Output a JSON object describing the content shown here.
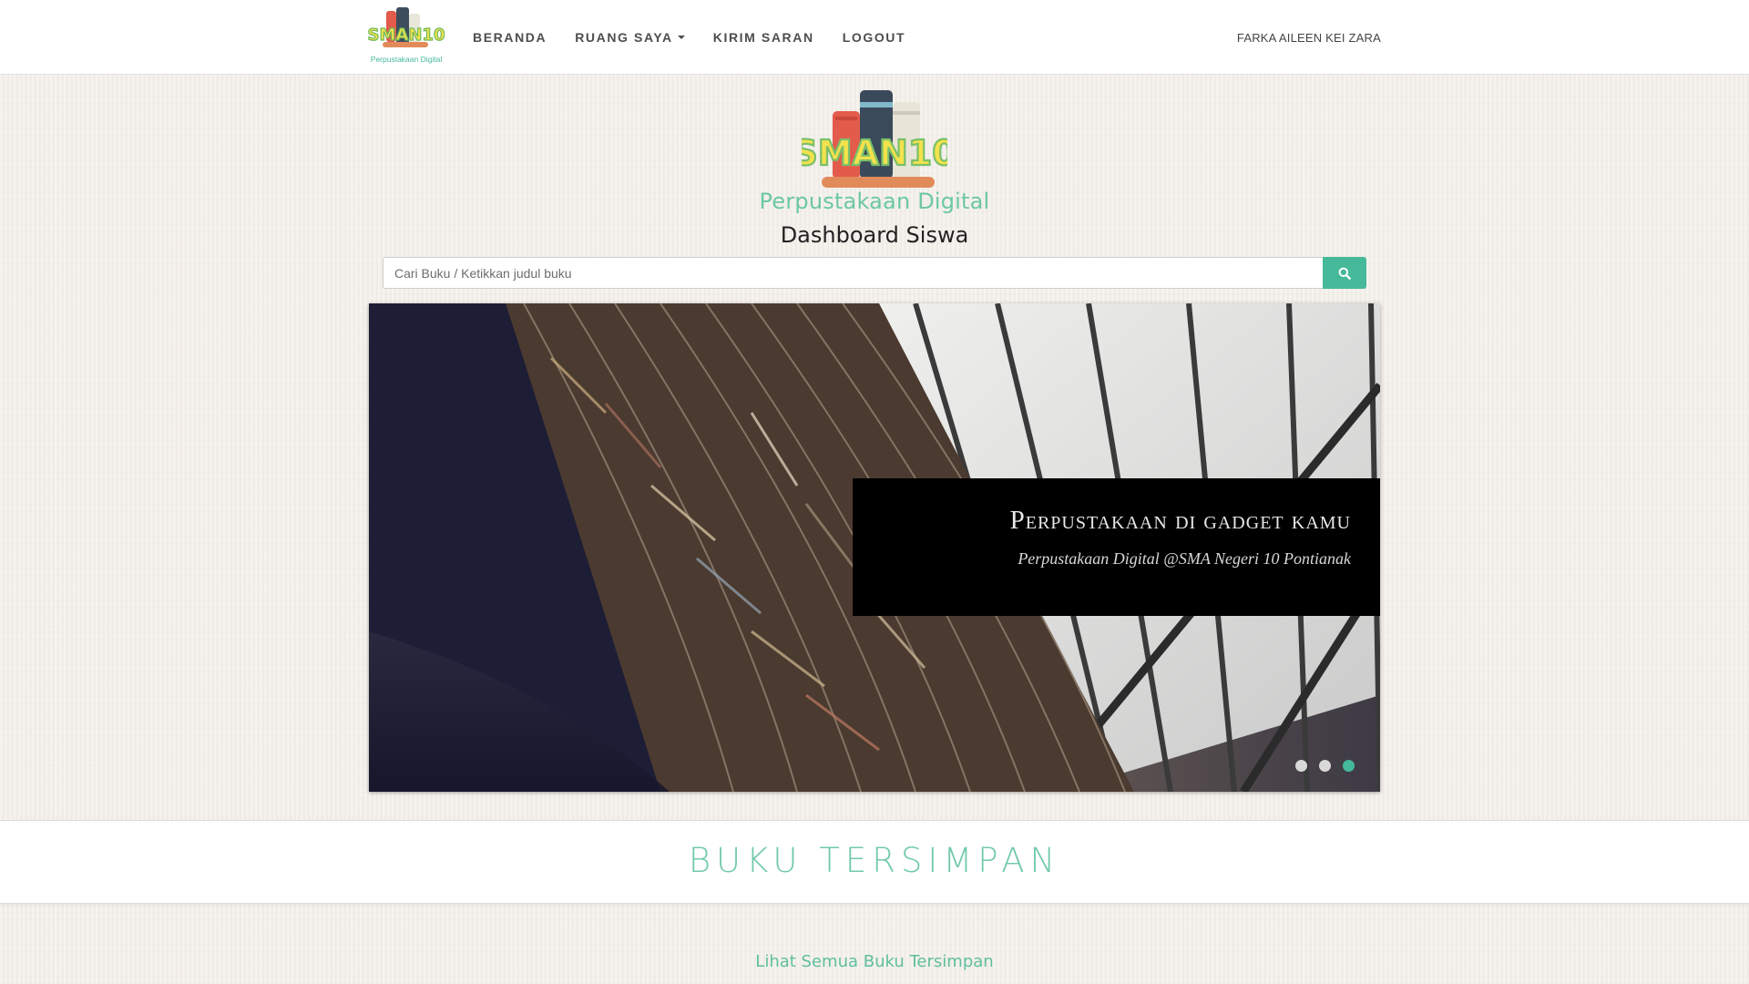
{
  "navbar": {
    "logo_text": "SMAN10",
    "logo_subtext": "Perpustakaan Digital",
    "links": [
      {
        "label": "BERANDA"
      },
      {
        "label": "RUANG SAYA",
        "dropdown": true
      },
      {
        "label": "KIRIM SARAN"
      },
      {
        "label": "LOGOUT"
      }
    ],
    "user_name": "FARKA AILEEN KEI ZARA"
  },
  "header": {
    "logo_text": "SMAN10",
    "brand_subtitle": "Perpustakaan Digital",
    "title": "Dashboard Siswa"
  },
  "search": {
    "placeholder": "Cari Buku / Ketikkan judul buku",
    "value": "",
    "button_icon": "search-icon"
  },
  "carousel": {
    "slide_count": 3,
    "active_index": 2,
    "caption_title": "Perpustakaan di gadget kamu",
    "caption_subtitle": "Perpustakaan Digital @SMA Negeri 10 Pontianak"
  },
  "saved_books": {
    "title": "BUKU TERSIMPAN",
    "see_all": "Lihat Semua Buku Tersimpan"
  },
  "colors": {
    "accent": "#45b99a",
    "brand_green": "#6cc8a2",
    "navbar_bg": "#ffffff",
    "page_bg": "#f3efea"
  }
}
